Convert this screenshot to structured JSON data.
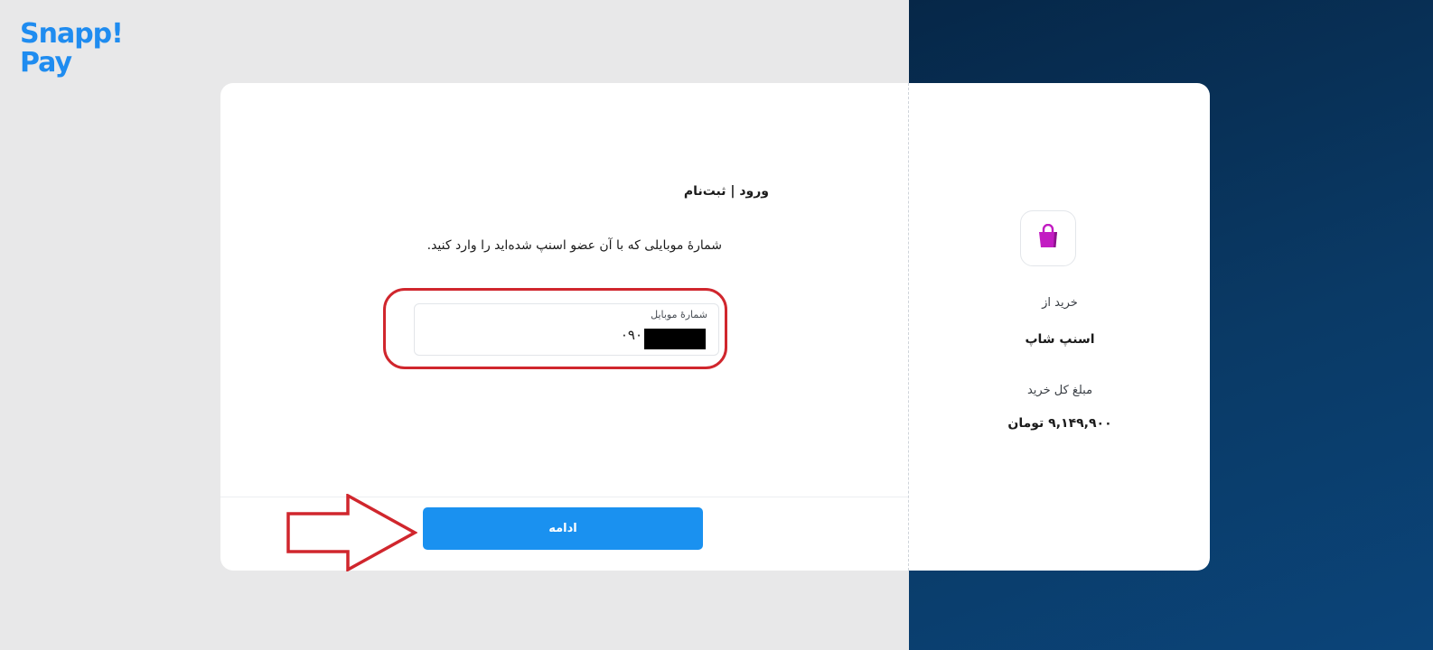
{
  "brand": {
    "logo_line1": "Snapp!",
    "logo_line2": "Pay",
    "logo_color": "#1f8cf0"
  },
  "form": {
    "title": "ورود | ثبت‌نام",
    "description": "شمارهٔ موبایلی که با آن عضو اسنپ شده‌اید را وارد کنید.",
    "phone_field": {
      "label": "شمارهٔ موبایل",
      "value": "۰۹۰"
    },
    "continue_label": "ادامه"
  },
  "summary": {
    "shop_icon": "shopping-bag-icon",
    "purchase_from_label": "خرید از",
    "shop_name": "اسنپ شاپ",
    "total_label": "مبلغ کل خرید",
    "total_amount": "۹,۱۴۹,۹۰۰ تومان"
  },
  "colors": {
    "primary_button": "#1a91f0",
    "highlight": "#d0262d",
    "bag": "#c21cc2",
    "right_bg": "#0a3a66"
  }
}
